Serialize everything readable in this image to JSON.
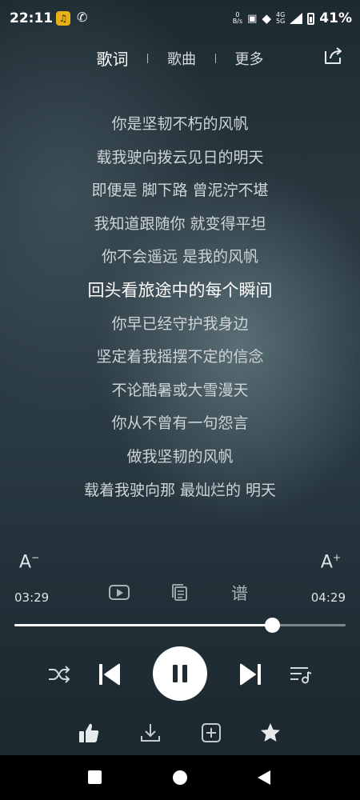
{
  "status": {
    "time": "22:11",
    "app_icon_glyph": "♫",
    "net_speed_top": "0",
    "net_speed_bottom": "B/s",
    "net_type_top": "4G",
    "net_type_bottom": "5G",
    "battery": "41%"
  },
  "tabs": {
    "lyrics": "歌词",
    "song": "歌曲",
    "more": "更多"
  },
  "lyrics": [
    "你是坚韧不朽的风帆",
    "载我驶向拨云见日的明天",
    "即便是 脚下路 曾泥泞不堪",
    "我知道跟随你 就变得平坦",
    "你不会遥远 是我的风帆",
    "回头看旅途中的每个瞬间",
    "你早已经守护我身边",
    "坚定着我摇摆不定的信念",
    "不论酷暑或大雪漫天",
    "你从不曾有一句怨言",
    "做我坚韧的风帆",
    "载着我驶向那 最灿烂的 明天"
  ],
  "current_line_index": 5,
  "font_controls": {
    "smaller": "A",
    "smaller_sup": "−",
    "larger": "A",
    "larger_sup": "+"
  },
  "score_label": "谱",
  "player": {
    "current_time": "03:29",
    "total_time": "04:29",
    "progress_fraction": 0.777
  },
  "icons": [
    "share-icon",
    "video-icon",
    "copy-lyrics-icon",
    "score-icon",
    "shuffle-icon",
    "previous-icon",
    "pause-icon",
    "next-icon",
    "playlist-icon",
    "like-icon",
    "download-icon",
    "add-icon",
    "star-icon"
  ]
}
